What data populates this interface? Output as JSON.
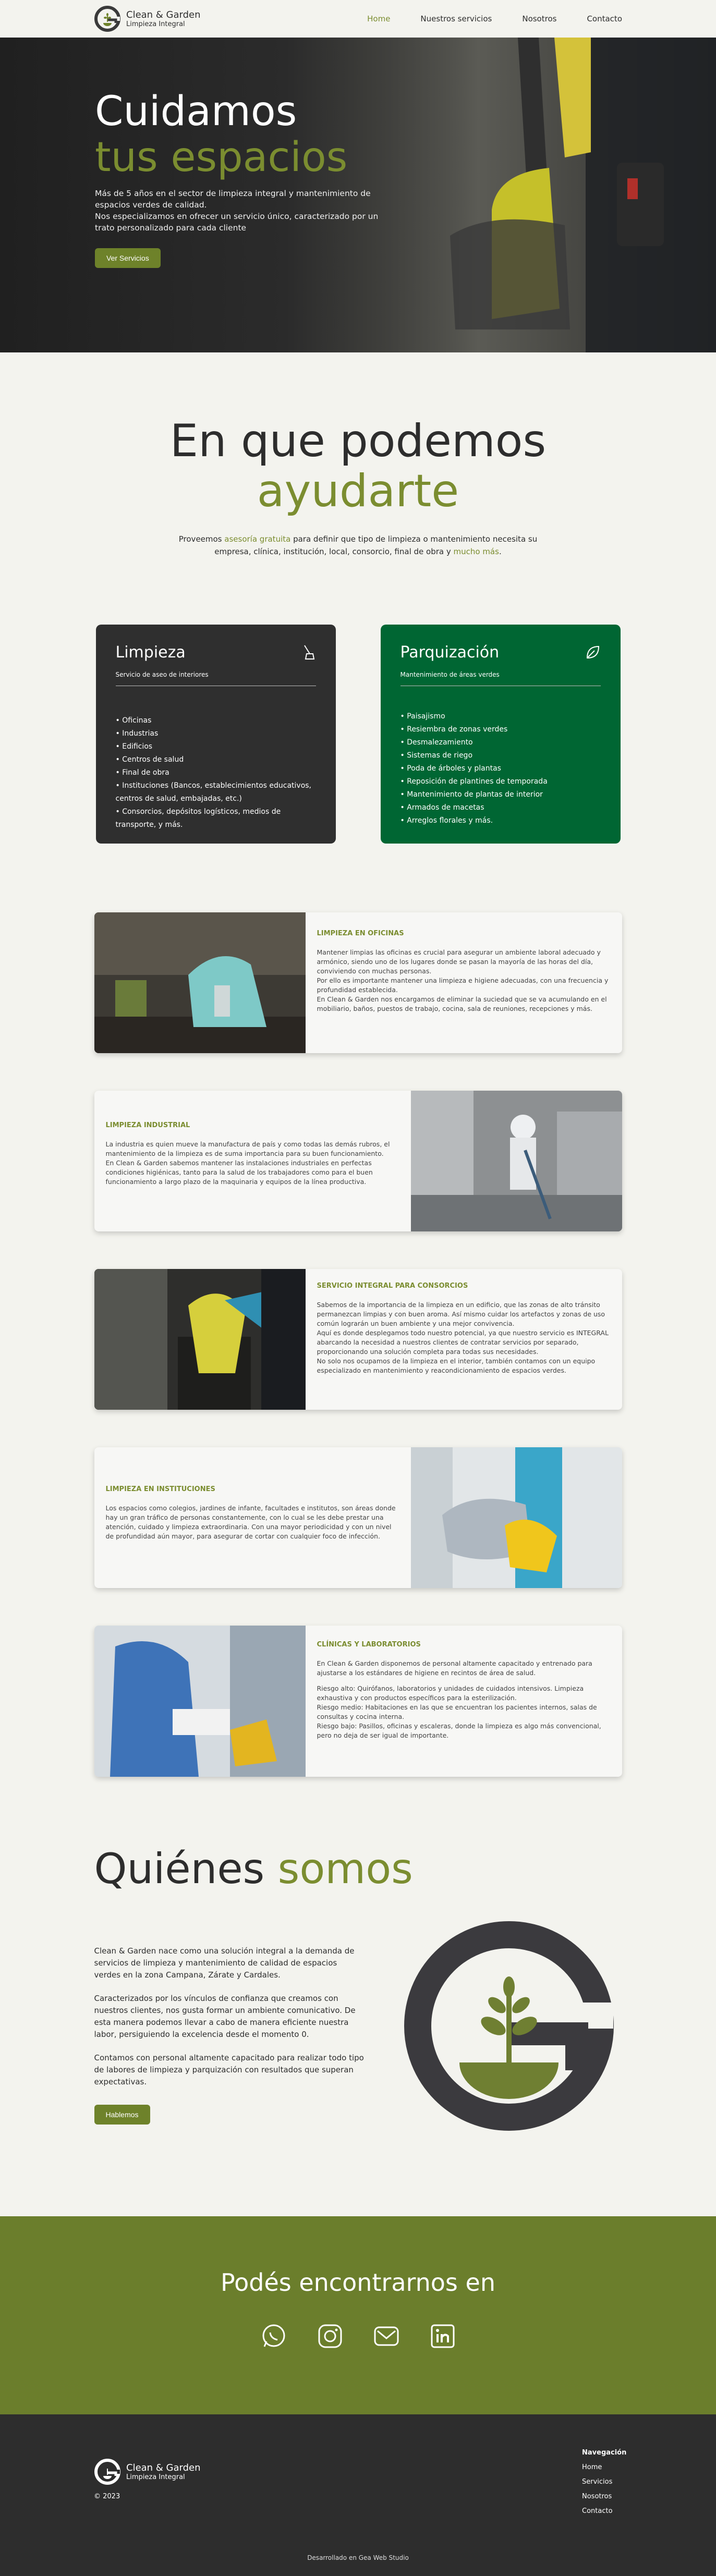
{
  "header": {
    "brand_name": "Clean & Garden",
    "brand_sub": "Limpieza Integral",
    "nav": [
      "Home",
      "Nuestros servicios",
      "Nosotros",
      "Contacto"
    ]
  },
  "hero": {
    "title_line1": "Cuidamos",
    "title_line2": "tus espacios",
    "text1": "Más de 5 años en el sector de limpieza integral y mantenimiento de espacios verdes de calidad.",
    "text2": "Nos especializamos en ofrecer un servicio único, caracterizado por un trato personalizado para cada cliente",
    "button": "Ver Servicios"
  },
  "help": {
    "title_line1": "En que podemos",
    "title_line2": "ayudarte",
    "intro_a": "Proveemos ",
    "intro_link1": "asesoría gratuita",
    "intro_b": " para definir que tipo de limpieza o mantenimiento necesita su empresa, clínica, institución, local, consorcio, final de obra y ",
    "intro_link2": "mucho más",
    "intro_c": "."
  },
  "services": [
    {
      "title": "Limpieza",
      "subtitle": "Servicio de aseo de interiores",
      "icon": "broom-icon",
      "items": [
        "Oficinas",
        "Industrias",
        "Edificios",
        "Centros de salud",
        "Final de obra",
        "Instituciones (Bancos, establecimientos educativos, centros de salud, embajadas, etc.)",
        "Consorcios, depósitos logísticos, medios de transporte, y más."
      ]
    },
    {
      "title": "Parquización",
      "subtitle": "Mantenimiento de áreas verdes",
      "icon": "leaf-icon",
      "items": [
        "Paisajismo",
        "Resiembra de zonas verdes",
        "Desmalezamiento",
        "Sistemas de riego",
        "Poda de árboles y plantas",
        "Reposición de plantines de temporada",
        "Mantenimiento de plantas de interior",
        "Armados de macetas",
        "Arreglos florales y más."
      ]
    }
  ],
  "features": [
    {
      "title": "LIMPIEZA EN OFICINAS",
      "paragraphs": [
        "Mantener limpias las oficinas es crucial para asegurar un ambiente laboral adecuado y armónico, siendo uno de los lugares donde se pasan la mayoría de las horas del día, conviviendo con muchas personas.",
        "Por ello es importante mantener una limpieza e higiene adecuadas, con una frecuencia y profundidad establecida.",
        "En Clean & Garden nos encargamos de eliminar la suciedad que se va acumulando en el mobiliario, baños, puestos de trabajo, cocina, sala de reuniones, recepciones y más."
      ]
    },
    {
      "title": "LIMPIEZA INDUSTRIAL",
      "paragraphs": [
        "La industria es quien mueve la manufactura de país y como todas las demás rubros, el mantenimiento de la limpieza es de suma importancia para su buen funcionamiento.",
        "En Clean & Garden sabemos mantener las instalaciones industriales en perfectas condiciones higiénicas, tanto para la salud de los trabajadores como para el buen funcionamiento a largo plazo de la maquinaria y equipos de la línea productiva."
      ]
    },
    {
      "title": "SERVICIO INTEGRAL PARA CONSORCIOS",
      "paragraphs": [
        "Sabemos de la importancia de la limpieza en un edificio, que las zonas de alto tránsito permanezcan limpias y con buen aroma. Así mismo cuidar los artefactos y zonas de uso común lograrán un buen ambiente y una mejor convivencia.",
        "Aquí es donde desplegamos todo nuestro potencial, ya que nuestro servicio es INTEGRAL abarcando la necesidad a nuestros clientes de contratar servicios por separado, proporcionando una solución completa para todas sus necesidades.",
        "No solo nos ocupamos de la limpieza en el interior, también contamos con un equipo especializado en mantenimiento y reacondicionamiento de espacios verdes."
      ]
    },
    {
      "title": "LIMPIEZA EN INSTITUCIONES",
      "paragraphs": [
        "Los espacios como colegios, jardines de infante, facultades e institutos, son áreas donde hay un gran tráfico de personas constantemente, con lo cual se les debe prestar una atención, cuidado y limpieza extraordinaria. Con una mayor periodicidad y con un nivel de profundidad aún mayor, para asegurar de cortar con cualquier foco de infección."
      ]
    },
    {
      "title": "CLÍNICAS Y LABORATORIOS",
      "paragraphs": [
        "En Clean & Garden disponemos de personal altamente capacitado y entrenado para ajustarse a los estándares de higiene en recintos de área de salud.",
        "Riesgo alto: Quirófanos, laboratorios y unidades de cuidados intensivos. Limpieza exhaustiva y con productos específicos para la esterilización.",
        "Riesgo medio: Habitaciones en las que se encuentran los pacientes internos, salas de consultas y cocina interna.",
        "Riesgo bajo: Pasillos, oficinas y escaleras, donde la limpieza es algo más convencional, pero no deja de ser igual de importante."
      ]
    }
  ],
  "about": {
    "title_a": "Quiénes",
    "title_b": "somos",
    "paragraphs": [
      "Clean & Garden nace como una solución integral a la demanda de servicios de limpieza y mantenimiento de calidad de espacios verdes en la zona Campana, Zárate y Cardales.",
      "Caracterizados por los vínculos de confianza que creamos con nuestros clientes, nos gusta formar un ambiente comunicativo. De esta manera podemos llevar a cabo de manera eficiente nuestra labor, persiguiendo la excelencia desde el momento 0.",
      "Contamos con personal altamente capacitado para realizar todo tipo de labores de limpieza y parquización con resultados que superan expectativas."
    ],
    "button": "Hablemos"
  },
  "contact": {
    "title": "Podés encontrarnos en",
    "icons": [
      "whatsapp-icon",
      "instagram-icon",
      "mail-icon",
      "linkedin-icon"
    ]
  },
  "footer": {
    "brand_name": "Clean & Garden",
    "brand_sub": "Limpieza Integral",
    "year": "© 2023",
    "nav_title": "Navegación",
    "nav": [
      "Home",
      "Servicios",
      "Nosotros",
      "Contacto"
    ],
    "credit": "Desarrollado en Gea Web Studio"
  },
  "colors": {
    "olive": "#7b8d30",
    "green_card": "#006633",
    "dark": "#2f2f2f",
    "band": "#6b7e2c"
  }
}
